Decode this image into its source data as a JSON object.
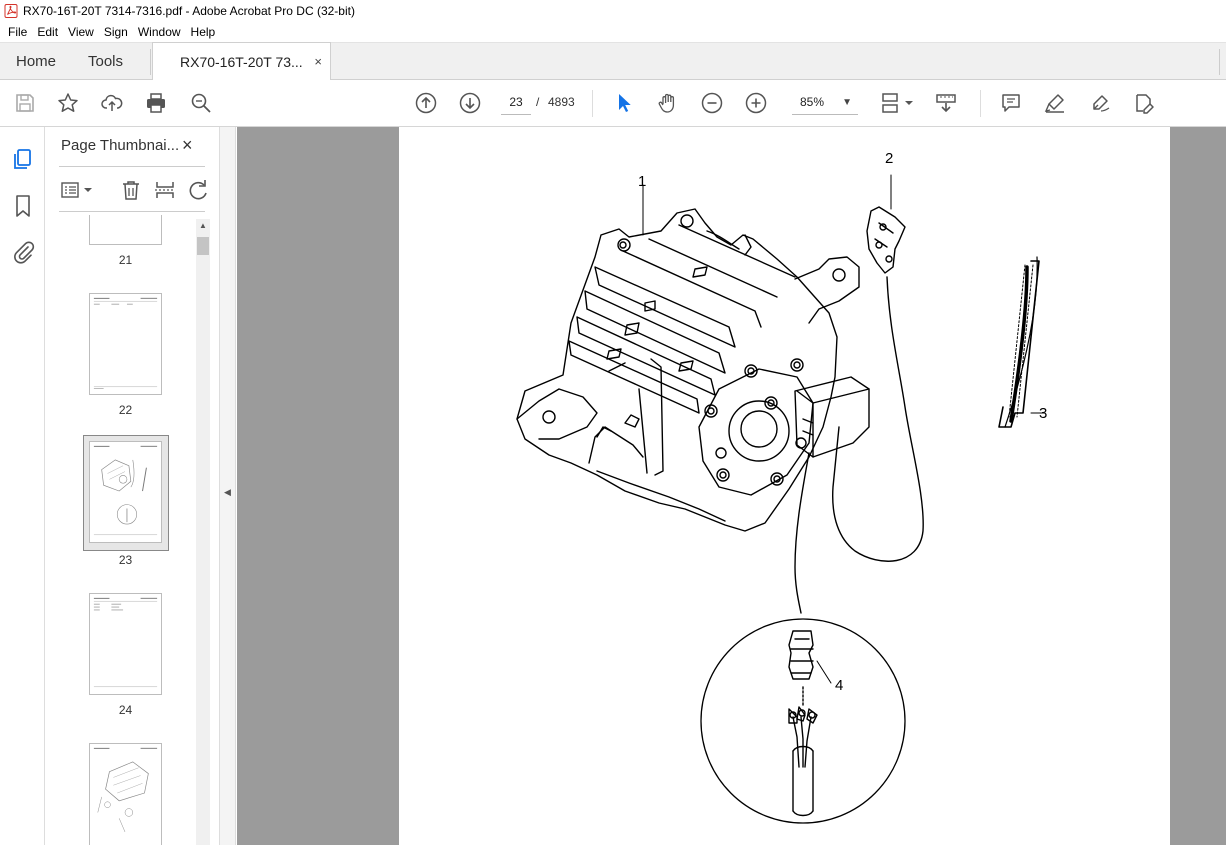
{
  "window": {
    "title": "RX70-16T-20T  7314-7316.pdf - Adobe Acrobat Pro DC (32-bit)"
  },
  "menu": [
    "File",
    "Edit",
    "View",
    "Sign",
    "Window",
    "Help"
  ],
  "tabs": {
    "home": "Home",
    "tools": "Tools",
    "document": "RX70-16T-20T  73...",
    "close_symbol": "×"
  },
  "toolbar": {
    "current_page": "23",
    "page_separator": "/",
    "total_pages": "4893",
    "zoom": "85%"
  },
  "thumbnails": {
    "panel_title": "Page Thumbnai...",
    "pages": [
      "21",
      "22",
      "23",
      "24"
    ],
    "selected_page": "23"
  },
  "drawing": {
    "callouts": [
      "1",
      "2",
      "3",
      "4"
    ]
  },
  "colors": {
    "accent_blue": "#1473e6",
    "canvas_gray": "#9b9b9b",
    "pdf_red": "#d4332a"
  }
}
